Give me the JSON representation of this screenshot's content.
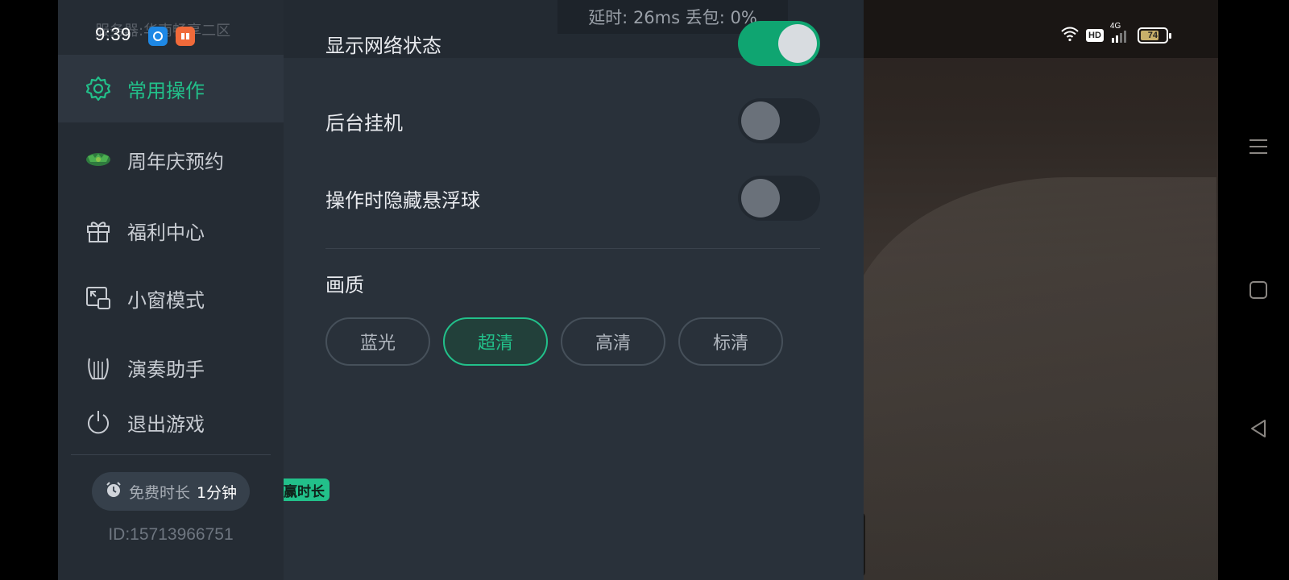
{
  "status_bar": {
    "time": "9:39",
    "battery": "74",
    "network": "4G",
    "hd": "HD"
  },
  "server_label": "服务器:华南畅享二区",
  "latency_text": "延时: 26ms 丢包: 0%",
  "sidebar": {
    "items": [
      {
        "label": "常用操作",
        "icon": "gear-icon",
        "active": true
      },
      {
        "label": "周年庆预约",
        "icon": "anniversary-icon",
        "active": false
      },
      {
        "label": "福利中心",
        "icon": "gift-icon",
        "active": false
      },
      {
        "label": "小窗模式",
        "icon": "mini-window-icon",
        "active": false
      },
      {
        "label": "演奏助手",
        "icon": "lyre-icon",
        "active": false
      },
      {
        "label": "退出游戏",
        "icon": "power-icon",
        "active": false
      }
    ],
    "free_time_label": "免费时长",
    "free_time_value": "1分钟",
    "user_id": "ID:15713966751"
  },
  "settings": {
    "show_network_status": {
      "label": "显示网络状态",
      "on": true
    },
    "background_idle": {
      "label": "后台挂机",
      "on": false
    },
    "hide_float_ball": {
      "label": "操作时隐藏悬浮球",
      "on": false
    }
  },
  "quality": {
    "title": "画质",
    "options": [
      "蓝光",
      "超清",
      "高清",
      "标清"
    ],
    "selected": "超清"
  },
  "earn_badge": "赢时长",
  "colors": {
    "accent": "#22c08a",
    "sidebar_bg": "#252c34",
    "panel_bg": "#29313a"
  }
}
